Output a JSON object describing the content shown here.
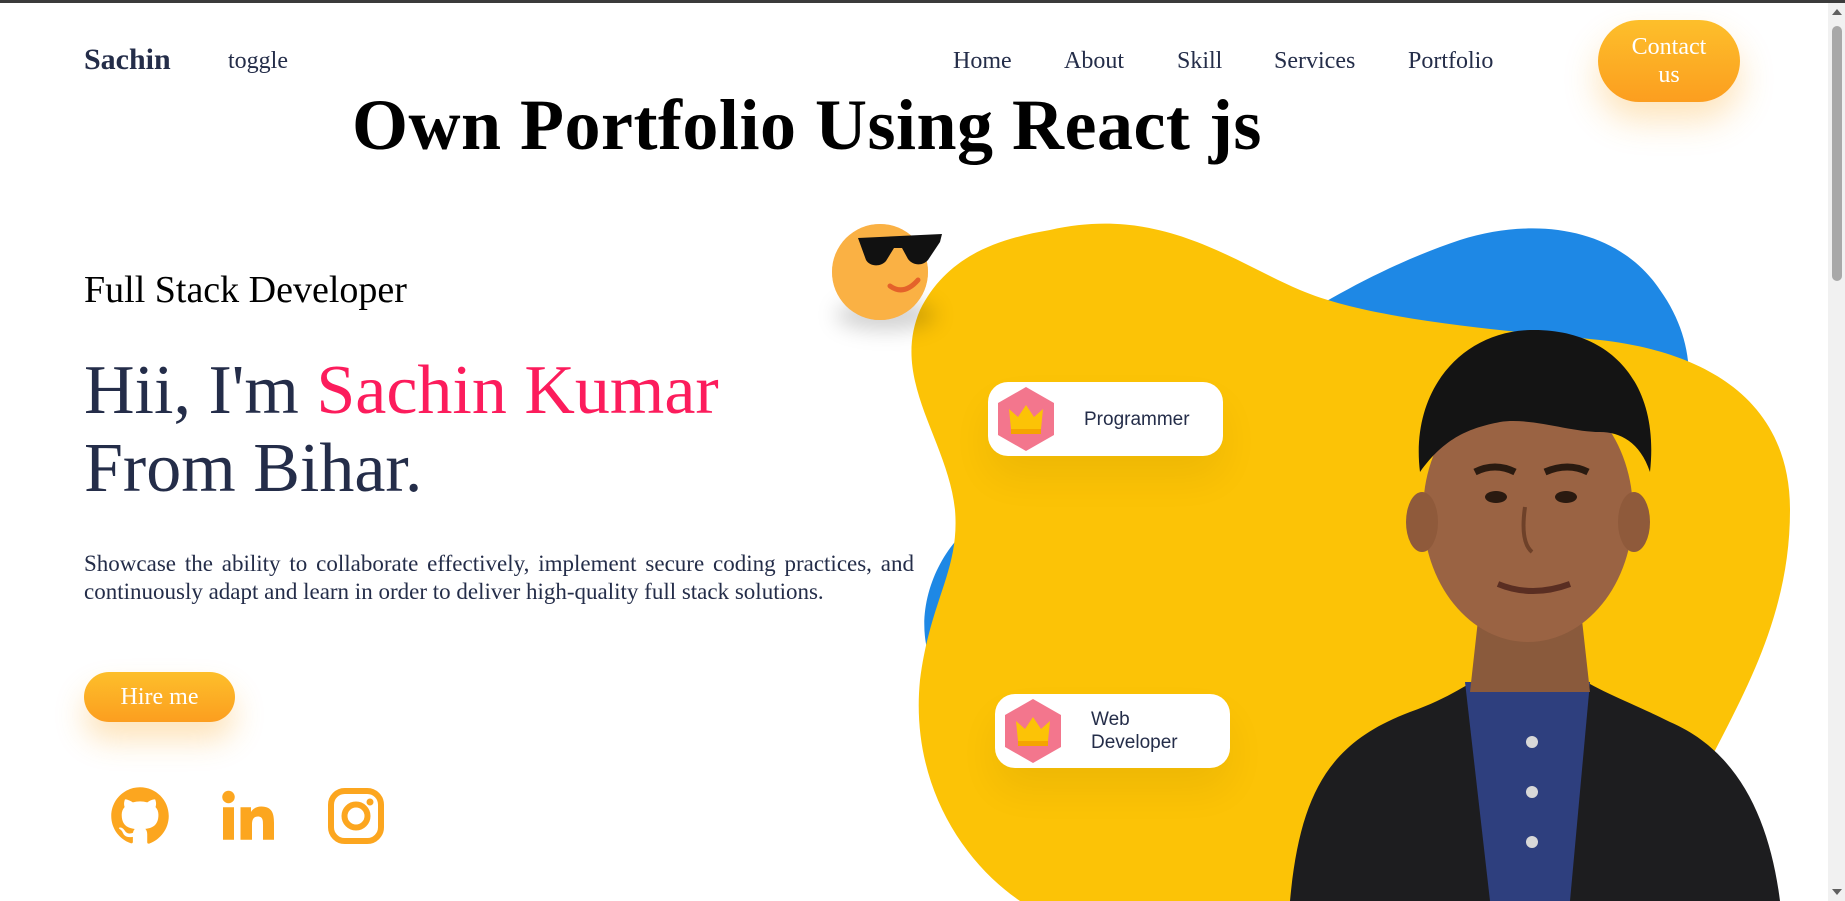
{
  "nav": {
    "brand": "Sachin",
    "toggle": "toggle",
    "links": [
      "Home",
      "About",
      "Skill",
      "Services",
      "Portfolio"
    ],
    "contact": "Contact us"
  },
  "title": "Own Portfolio Using React js",
  "hero": {
    "role": "Full Stack Developer",
    "greeting_prefix": "Hii, I'm ",
    "name": "Sachin Kumar",
    "origin": "From Bihar.",
    "description": "Showcase the ability to collaborate effectively, implement secure coding practices, and continuously adapt and learn in order to deliver high-quality full stack solutions.",
    "hire": "Hire me"
  },
  "social": [
    "github-icon",
    "linkedin-icon",
    "instagram-icon"
  ],
  "badges": [
    {
      "label": "Programmer",
      "icon": "crown-icon"
    },
    {
      "label": "Web Developer",
      "icon": "crown-icon"
    }
  ],
  "colors": {
    "accent": "#fca61f",
    "name": "#fc1c5c",
    "text": "#242d49",
    "blob_yellow": "#fcc306",
    "blob_blue": "#1e88e5"
  }
}
